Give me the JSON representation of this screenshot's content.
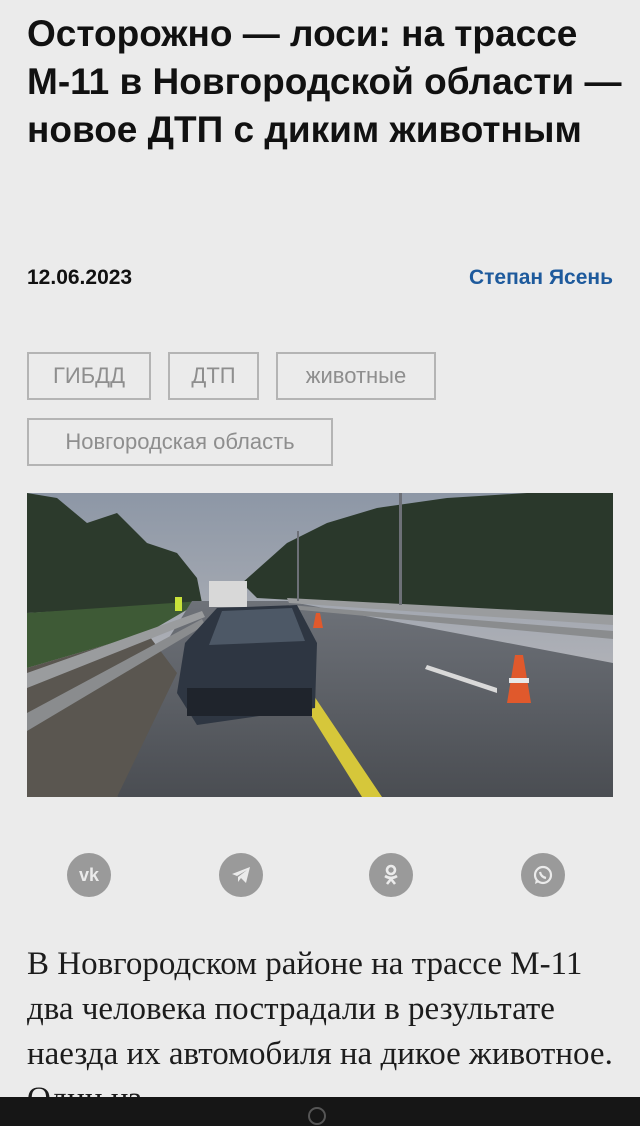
{
  "article": {
    "title": "Осторожно — лоси: на трассе М-11 в Новгородской области — новое ДТП с диким животным",
    "date": "12.06.2023",
    "author": "Степан Ясень",
    "tags": [
      "ГИБДД",
      "ДТП",
      "животные",
      "Новгородская область"
    ],
    "body": "В Новгородском районе на трассе М-11 два человека пострадали в результате наезда их автомобиля на дикое животное. Один из"
  },
  "share": {
    "icons": [
      "vk-icon",
      "telegram-icon",
      "odnoklassniki-icon",
      "whatsapp-icon"
    ],
    "vk_glyph": "vk"
  },
  "colors": {
    "background": "#ebebeb",
    "title": "#111111",
    "author_link": "#1e5a9c",
    "tag_border": "#b4b4b4",
    "tag_text": "#8e8e8e",
    "share_icon": "#9a9a9a",
    "bottom_bar": "#161616"
  }
}
